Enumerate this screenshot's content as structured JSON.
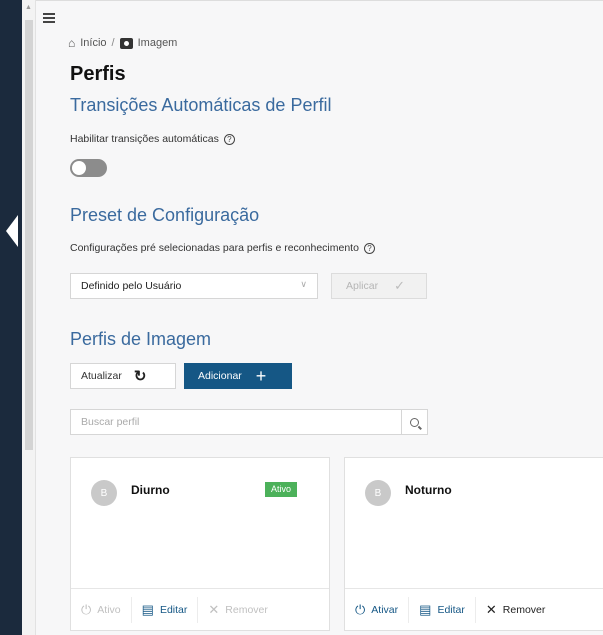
{
  "breadcrumb": {
    "home": "Início",
    "separator": "/",
    "current": "Imagem"
  },
  "page_title": "Perfis",
  "auto_transitions": {
    "heading": "Transições Automáticas de Perfil",
    "enable_label": "Habilitar transições automáticas",
    "enabled": false
  },
  "preset": {
    "heading": "Preset de Configuração",
    "description": "Configurações pré selecionadas para perfis e reconhecimento",
    "selected": "Definido pelo Usuário",
    "apply_label": "Aplicar"
  },
  "image_profiles": {
    "heading": "Perfis de Imagem",
    "refresh_label": "Atualizar",
    "add_label": "Adicionar",
    "search_placeholder": "Buscar perfil"
  },
  "profiles": [
    {
      "name": "Diurno",
      "badge": "Ativo",
      "avatar": "B",
      "actions": {
        "activate": "Ativo",
        "edit": "Editar",
        "remove": "Remover"
      }
    },
    {
      "name": "Noturno",
      "badge": "",
      "avatar": "B",
      "actions": {
        "activate": "Ativar",
        "edit": "Editar",
        "remove": "Remover"
      }
    }
  ],
  "icons": [
    "menu-icon",
    "home-icon",
    "camera-icon",
    "help-icon",
    "chevron-down-icon",
    "check-icon",
    "refresh-icon",
    "plus-icon",
    "search-icon",
    "power-icon",
    "edit-icon",
    "close-icon"
  ],
  "colors": {
    "primary": "#155785",
    "heading": "#3a6a9e",
    "active_badge": "#4cb15a",
    "sidebar": "#1b2a3d"
  }
}
